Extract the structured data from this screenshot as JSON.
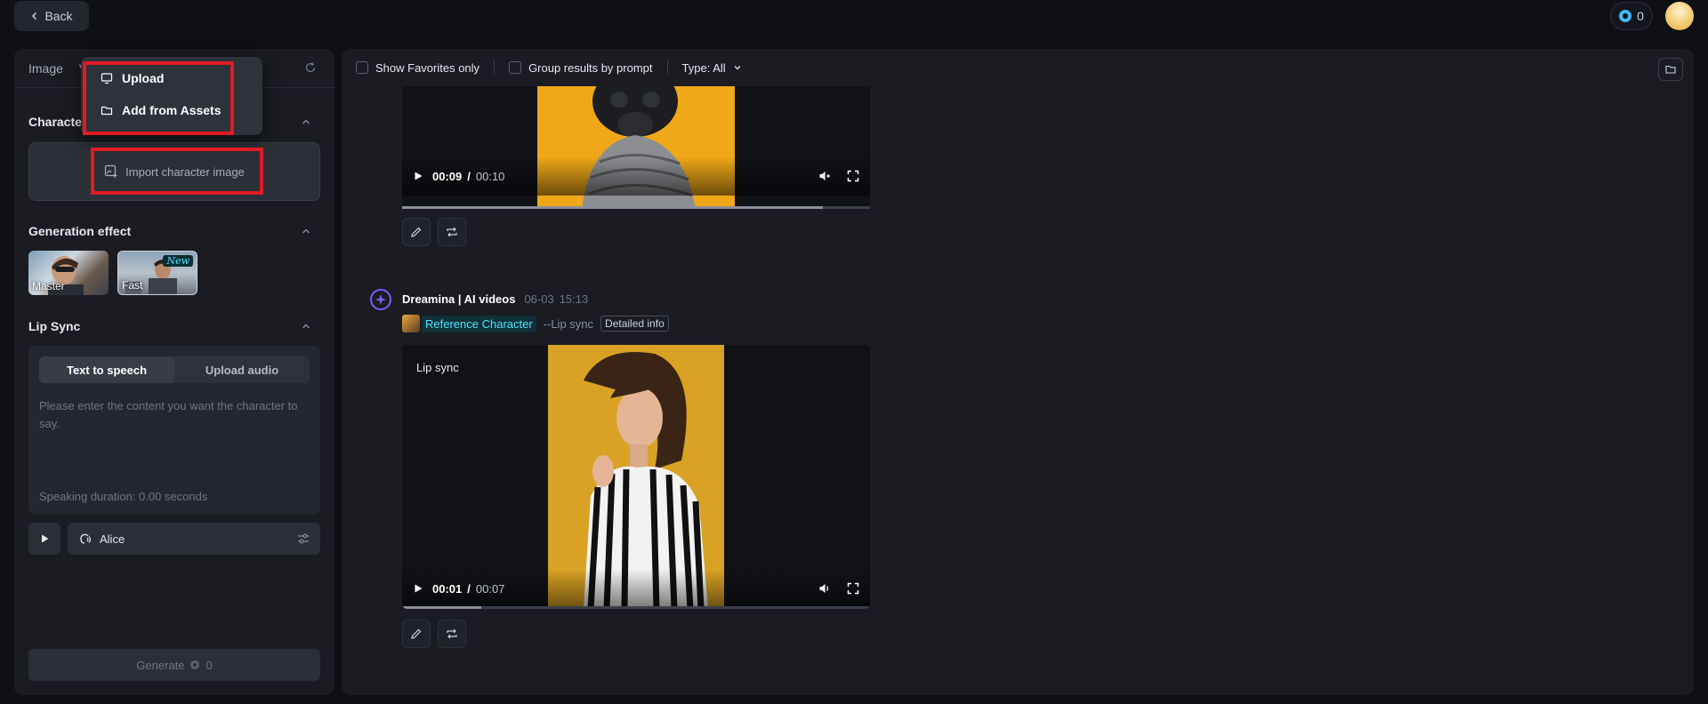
{
  "topbar": {
    "back_label": "Back",
    "credits": "0"
  },
  "left": {
    "tabs": [
      "Image",
      "V"
    ],
    "character_title": "Character",
    "import_label": "Import character image",
    "effect_title": "Generation effect",
    "effects": [
      {
        "label": "Master"
      },
      {
        "label": "Fast",
        "badge": "New"
      }
    ],
    "lip_title": "Lip Sync",
    "lip_tabs": [
      "Text to speech",
      "Upload audio"
    ],
    "lip_placeholder": "Please enter the content you want the character to say.",
    "lip_duration": "Speaking duration: 0.00 seconds",
    "voice_name": "Alice",
    "generate_label": "Generate",
    "generate_cost": "0"
  },
  "dropdown": {
    "items": [
      "Upload",
      "Add from Assets"
    ]
  },
  "main": {
    "toolbar": {
      "favorites": "Show Favorites only",
      "group": "Group results by prompt",
      "type": "Type: All"
    },
    "video1": {
      "current": "00:09",
      "slash": "/",
      "duration": "00:10",
      "progress": 0.9
    },
    "generation": {
      "name": "Dreamina | AI videos",
      "date": "06-03",
      "time": "15:13",
      "ref_label": "Reference Character",
      "lip_tag": "--Lip sync",
      "detail_label": "Detailed info"
    },
    "video2": {
      "badge": "Lip sync",
      "current": "00:01",
      "slash": "/",
      "duration": "00:07",
      "progress": 0.17
    }
  },
  "colors": {
    "accent_red": "#e01b24",
    "badge_cyan": "#49e6ff",
    "logo_purple": "#7c5cff"
  }
}
